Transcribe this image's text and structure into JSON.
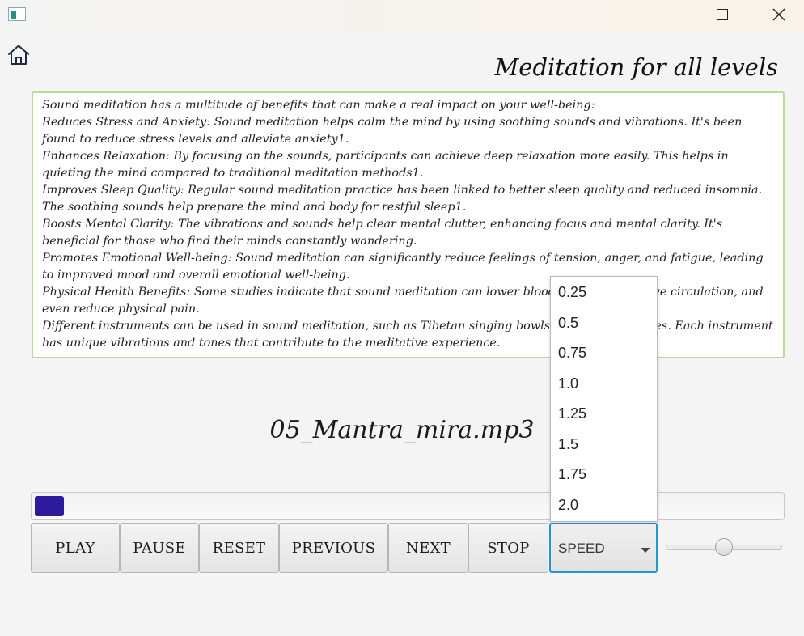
{
  "window": {
    "controls": [
      "minimize-icon",
      "maximize-icon",
      "close-icon"
    ]
  },
  "home": {
    "icon": "home-icon"
  },
  "heading": "Meditation for all levels",
  "description": [
    "Sound meditation has a multitude of benefits that can make a real impact on your well-being:",
    "Reduces Stress and Anxiety: Sound meditation helps calm the mind by using soothing sounds and vibrations. It's been found to reduce stress levels and alleviate anxiety1.",
    "Enhances Relaxation: By focusing on the sounds, participants can achieve deep relaxation more easily. This helps in quieting the mind compared to traditional meditation methods1.",
    "Improves Sleep Quality: Regular sound meditation practice has been linked to better sleep quality and reduced insomnia. The soothing sounds help prepare the mind and body for restful sleep1.",
    "Boosts Mental Clarity: The vibrations and sounds help clear mental clutter, enhancing focus and mental clarity. It's beneficial for those who find their minds constantly wandering.",
    "Promotes Emotional Well-being: Sound meditation can significantly reduce feelings of tension, anger, and fatigue, leading to improved mood and overall emotional well-being.",
    "Physical Health Benefits: Some studies indicate that sound meditation can lower blood pressure, improve circulation, and even reduce physical pain.",
    "Different instruments can be used in sound meditation, such as Tibetan singing bowls, gongs, and chimes. Each instrument has unique vibrations and tones that contribute to the meditative experience."
  ],
  "track": {
    "name": "05_Mantra_mira.mp3",
    "progress": 0.02
  },
  "controls": {
    "play": "PLAY",
    "pause": "PAUSE",
    "reset": "RESET",
    "previous": "PREVIOUS",
    "next": "NEXT",
    "stop": "STOP"
  },
  "speed": {
    "label": "SPEED",
    "options": [
      "0.25",
      "0.5",
      "0.75",
      "1.0",
      "1.25",
      "1.5",
      "1.75",
      "2.0"
    ]
  },
  "volume": {
    "value": 0.5
  },
  "colors": {
    "progress_fill": "#2e1a9d",
    "speed_focus_border": "#1f97d6",
    "textarea_border": "#b9dc8e"
  }
}
